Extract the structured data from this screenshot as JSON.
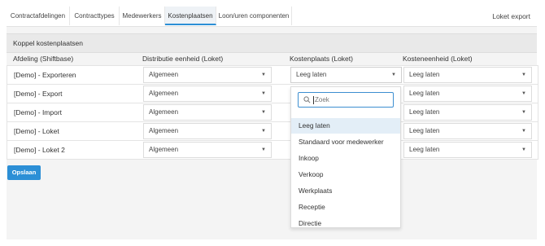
{
  "tabs": [
    {
      "label": "Contractafdelingen",
      "active": false
    },
    {
      "label": "Contracttypes",
      "active": false
    },
    {
      "label": "Medewerkers",
      "active": false
    },
    {
      "label": "Kostenplaatsen",
      "active": true
    },
    {
      "label": "Loon/uren componenten",
      "active": false
    }
  ],
  "header_right": "Loket export",
  "section_title": "Koppel kostenplaatsen",
  "columns": {
    "afdeling": "Afdeling (Shiftbase)",
    "distributie": "Distributie eenheid (Loket)",
    "kostenplaats": "Kostenplaats (Loket)",
    "kosteneenheid": "Kosteneenheid (Loket)"
  },
  "rows": [
    {
      "afdeling": "[Demo] - Exporteren",
      "distributie": "Algemeen",
      "kostenplaats": "Leeg laten",
      "kosteneenheid": "Leeg laten"
    },
    {
      "afdeling": "[Demo] - Export",
      "distributie": "Algemeen",
      "kostenplaats": "",
      "kosteneenheid": "Leeg laten"
    },
    {
      "afdeling": "[Demo] - Import",
      "distributie": "Algemeen",
      "kostenplaats": "",
      "kosteneenheid": "Leeg laten"
    },
    {
      "afdeling": "[Demo] - Loket",
      "distributie": "Algemeen",
      "kostenplaats": "",
      "kosteneenheid": "Leeg laten"
    },
    {
      "afdeling": "[Demo] - Loket 2",
      "distributie": "Algemeen",
      "kostenplaats": "",
      "kosteneenheid": "Leeg laten"
    }
  ],
  "save_label": "Opslaan",
  "dropdown": {
    "search_placeholder": "Zoek",
    "options": [
      "Leeg laten",
      "Standaard voor medewerker",
      "Inkoop",
      "Verkoop",
      "Werkplaats",
      "Receptie",
      "Directie"
    ],
    "selected": "Leeg laten"
  },
  "colors": {
    "accent": "#2c8fd6",
    "selected_option": "#e3eef7"
  }
}
